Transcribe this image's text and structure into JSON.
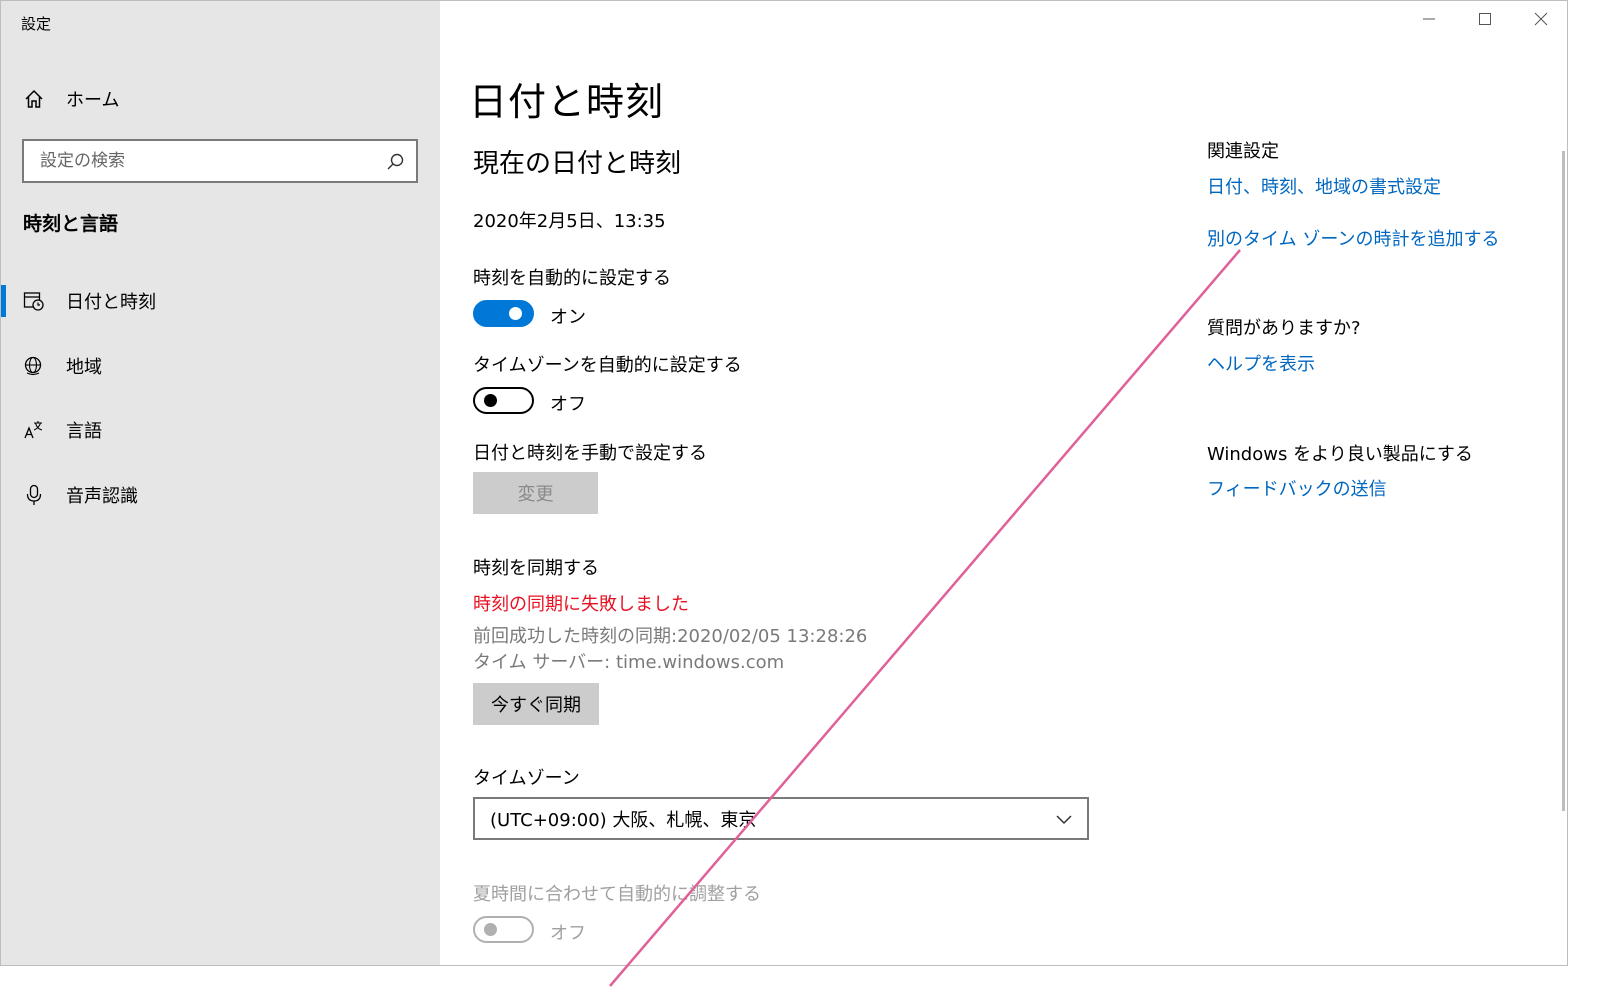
{
  "window": {
    "title": "設定"
  },
  "sidebar": {
    "home_label": "ホーム",
    "search_placeholder": "設定の検索",
    "section_title": "時刻と言語",
    "items": [
      {
        "label": "日付と時刻",
        "icon": "calendar-clock-icon",
        "active": true
      },
      {
        "label": "地域",
        "icon": "globe-icon",
        "active": false
      },
      {
        "label": "言語",
        "icon": "language-icon",
        "active": false
      },
      {
        "label": "音声認識",
        "icon": "microphone-icon",
        "active": false
      }
    ]
  },
  "main": {
    "page_title": "日付と時刻",
    "current_section_title": "現在の日付と時刻",
    "current_datetime": "2020年2月5日、13:35",
    "auto_time": {
      "label": "時刻を自動的に設定する",
      "state_label": "オン",
      "on": true
    },
    "auto_timezone": {
      "label": "タイムゾーンを自動的に設定する",
      "state_label": "オフ",
      "on": false
    },
    "manual": {
      "label": "日付と時刻を手動で設定する",
      "button_label": "変更"
    },
    "sync": {
      "label": "時刻を同期する",
      "error": "時刻の同期に失敗しました",
      "last_sync": "前回成功した時刻の同期:2020/02/05 13:28:26",
      "server": "タイム サーバー: time.windows.com",
      "button_label": "今すぐ同期"
    },
    "timezone": {
      "label": "タイムゾーン",
      "value": "(UTC+09:00) 大阪、札幌、東京"
    },
    "dst": {
      "label": "夏時間に合わせて自動的に調整する",
      "state_label": "オフ",
      "on": false,
      "disabled": true
    }
  },
  "related": {
    "heading": "関連設定",
    "links": [
      "日付、時刻、地域の書式設定",
      "別のタイム ゾーンの時計を追加する"
    ],
    "question_heading": "質問がありますか?",
    "help_link": "ヘルプを表示",
    "improve_heading": "Windows をより良い製品にする",
    "feedback_link": "フィードバックの送信"
  },
  "colors": {
    "accent": "#0078d7",
    "link": "#0067c0",
    "error": "#e81123",
    "sidebar_bg": "#e6e6e6",
    "annotation": "#e0609a"
  }
}
